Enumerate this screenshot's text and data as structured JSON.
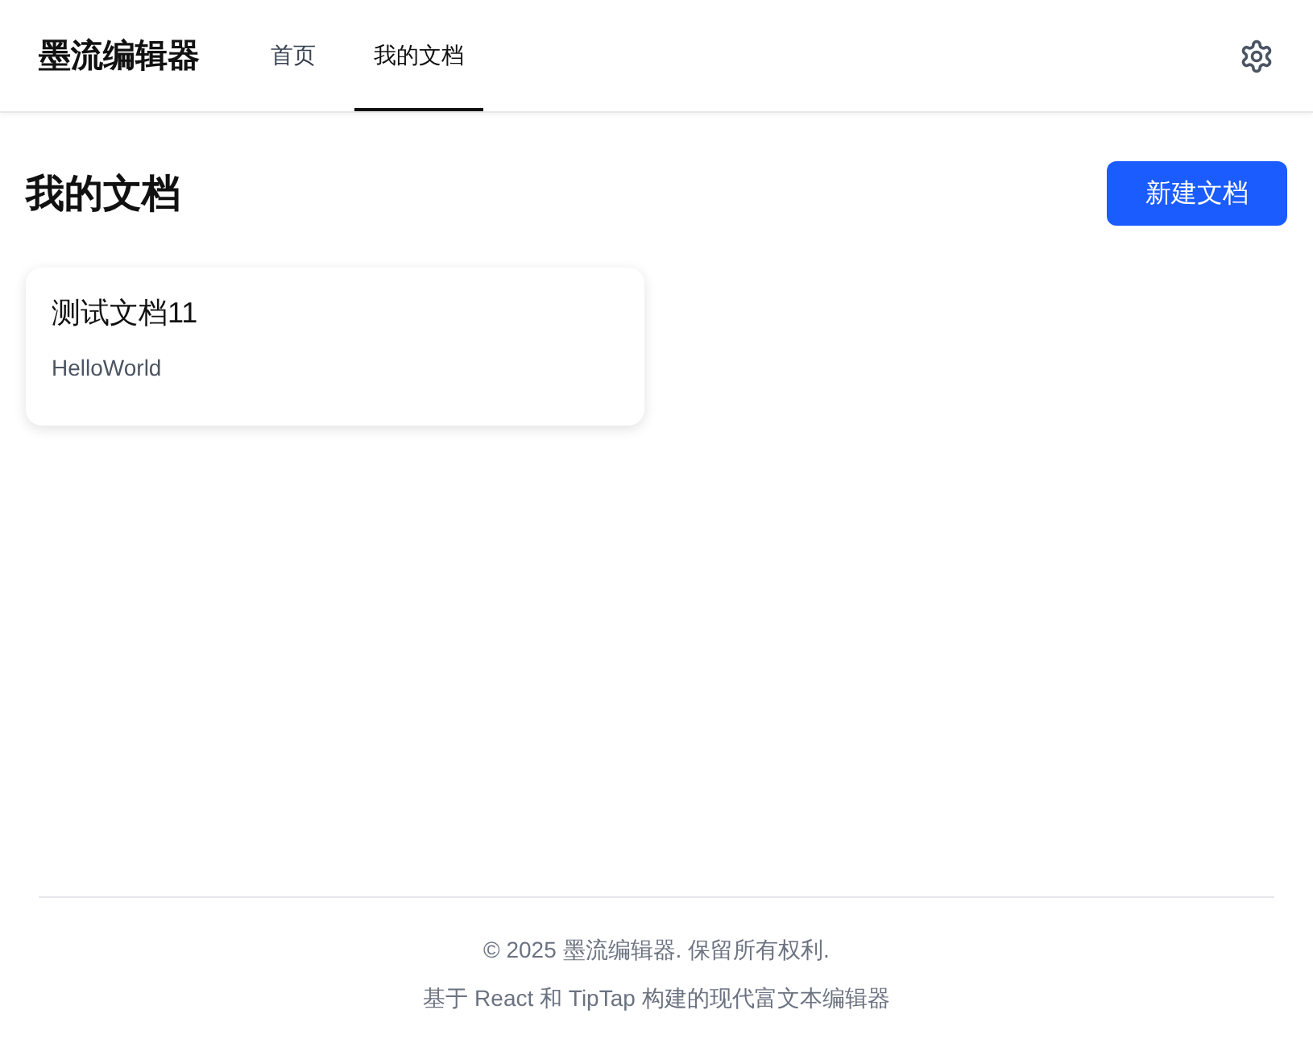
{
  "header": {
    "logo": "墨流编辑器",
    "nav": [
      {
        "label": "首页",
        "selected": false
      },
      {
        "label": "我的文档",
        "selected": true
      }
    ]
  },
  "page": {
    "title": "我的文档",
    "new_button": "新建文档"
  },
  "documents": [
    {
      "title": "测试文档11",
      "excerpt": "HelloWorld"
    }
  ],
  "footer": {
    "copyright": "© 2025 墨流编辑器. 保留所有权利.",
    "tagline": "基于 React 和 TipTap 构建的现代富文本编辑器"
  }
}
